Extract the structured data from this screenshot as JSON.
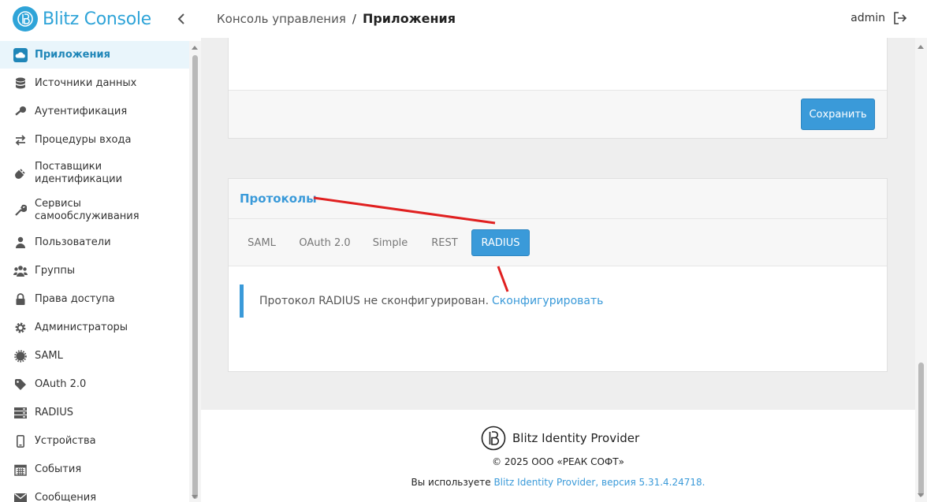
{
  "app": {
    "name": "Blitz Console"
  },
  "header": {
    "breadcrumb_root": "Консоль управления",
    "breadcrumb_sep": "/",
    "breadcrumb_current": "Приложения",
    "user": "admin"
  },
  "sidebar": {
    "items": [
      {
        "label": "Приложения",
        "icon": "cloud-icon"
      },
      {
        "label": "Источники данных",
        "icon": "database-icon"
      },
      {
        "label": "Аутентификация",
        "icon": "key-icon"
      },
      {
        "label": "Процедуры входа",
        "icon": "exchange-icon"
      },
      {
        "label": "Поставщики идентификации",
        "icon": "plug-icon"
      },
      {
        "label": "Сервисы самообслуживания",
        "icon": "wrench-icon"
      },
      {
        "label": "Пользователи",
        "icon": "user-icon"
      },
      {
        "label": "Группы",
        "icon": "users-icon"
      },
      {
        "label": "Права доступа",
        "icon": "lock-icon"
      },
      {
        "label": "Администраторы",
        "icon": "gear-icon"
      },
      {
        "label": "SAML",
        "icon": "cog-icon"
      },
      {
        "label": "OAuth 2.0",
        "icon": "tag-icon"
      },
      {
        "label": "RADIUS",
        "icon": "server-icon"
      },
      {
        "label": "Устройства",
        "icon": "mobile-icon"
      },
      {
        "label": "События",
        "icon": "calendar-icon"
      },
      {
        "label": "Сообщения",
        "icon": "envelope-icon"
      }
    ]
  },
  "main": {
    "save_label": "Сохранить",
    "protocols_title": "Протоколы",
    "tabs": [
      {
        "label": "SAML"
      },
      {
        "label": "OAuth 2.0"
      },
      {
        "label": "Simple"
      },
      {
        "label": "REST"
      },
      {
        "label": "RADIUS",
        "active": true
      }
    ],
    "notice_text": "Протокол RADIUS не сконфигурирован.",
    "notice_link": "Сконфигурировать"
  },
  "footer": {
    "product": "Blitz Identity Provider",
    "copyright": "© 2025 ООО «РЕАК СОФТ»",
    "version_prefix": "Вы используете",
    "version_link": "Blitz Identity Provider, версия 5.31.4.24718."
  },
  "colors": {
    "accent": "#3a9ad9",
    "brand": "#2fa4d8",
    "annotation": "#e02020"
  }
}
